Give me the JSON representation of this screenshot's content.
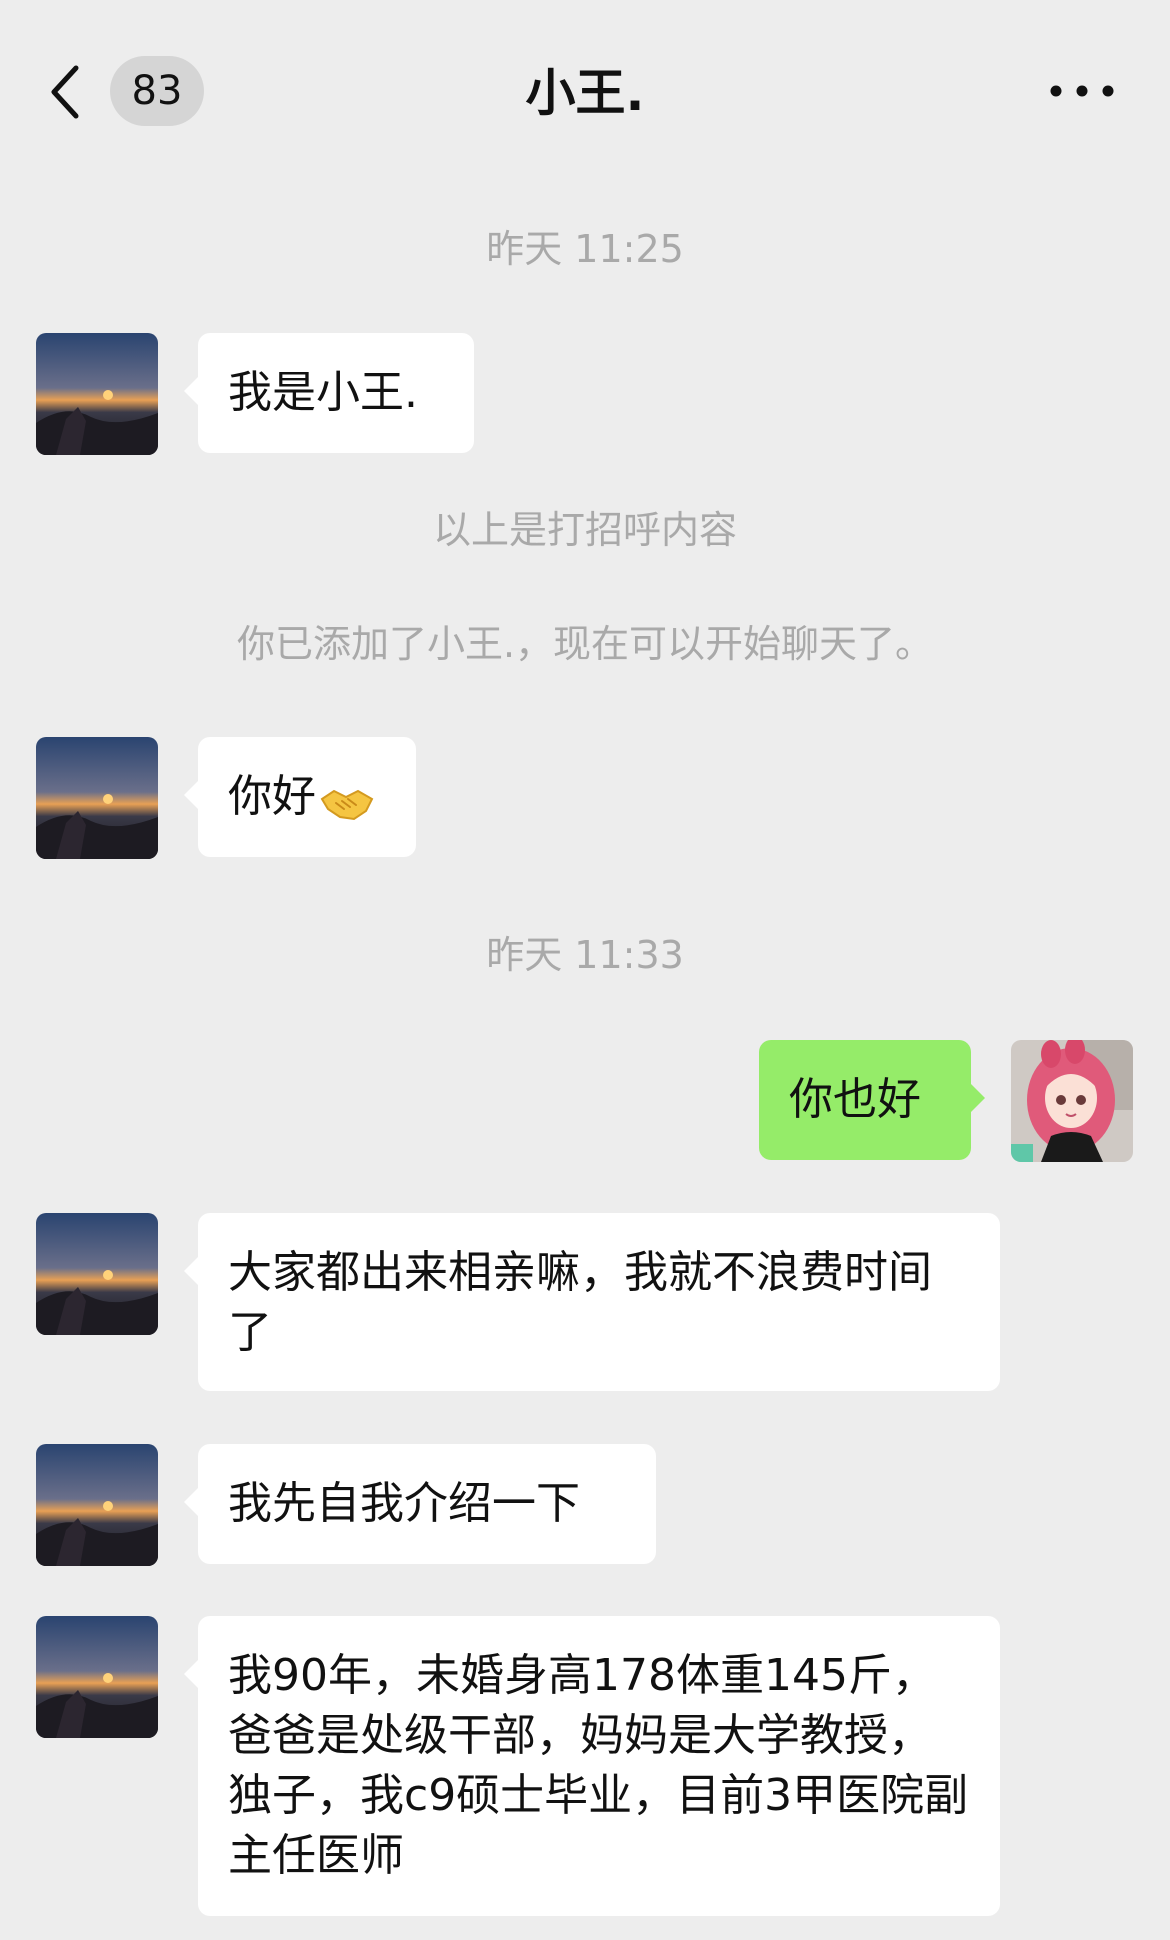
{
  "header": {
    "unread_count": "83",
    "title": "小王."
  },
  "chat": {
    "time_1": "昨天 11:25",
    "msg_1": "我是小王.",
    "greeting_note": "以上是打招呼内容",
    "added_note": "你已添加了小王.，现在可以开始聊天了。",
    "msg_2": "你好",
    "msg_2_emoji": "handshake-emoji",
    "time_2": "昨天 11:33",
    "msg_3": "你也好",
    "msg_4": "大家都出来相亲嘛，我就不浪费时间了",
    "msg_5": "我先自我介绍一下",
    "msg_6": "我90年，未婚身高178体重145斤，爸爸是处级干部，妈妈是大学教授，独子，我c9硕士毕业，目前3甲医院副主任医师"
  },
  "colors": {
    "background": "#ededed",
    "incoming_bubble": "#ffffff",
    "outgoing_bubble": "#95ec69",
    "system_text": "#a9a9a9",
    "badge": "#d5d5d5"
  }
}
